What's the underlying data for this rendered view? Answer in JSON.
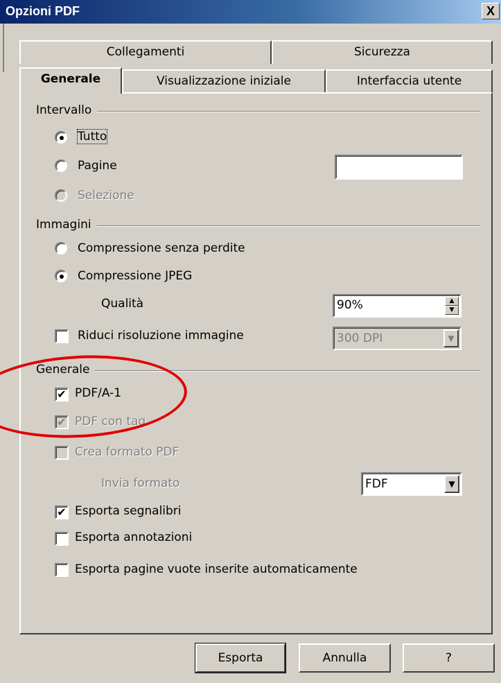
{
  "window": {
    "title": "Opzioni PDF",
    "close_glyph": "X"
  },
  "tabs": {
    "row_back": [
      "Collegamenti",
      "Sicurezza"
    ],
    "row_front": [
      "Generale",
      "Visualizzazione iniziale",
      "Interfaccia utente"
    ],
    "active": "Generale"
  },
  "intervallo": {
    "label": "Intervallo",
    "tutto": "Tutto",
    "pagine": "Pagine",
    "selezione": "Selezione",
    "selected": "Tutto",
    "pagine_value": ""
  },
  "immagini": {
    "label": "Immagini",
    "lossless": "Compressione senza perdite",
    "jpeg": "Compressione JPEG",
    "selected": "Compressione JPEG",
    "quality_label": "Qualità",
    "quality_value": "90%",
    "reduce_label": "Riduci risoluzione immagine",
    "reduce_checked": false,
    "dpi_value": "300 DPI"
  },
  "generale": {
    "label": "Generale",
    "pdfa": {
      "label": "PDF/A-1",
      "checked": true
    },
    "tagged": {
      "label": "PDF con tag",
      "checked": true,
      "disabled": true
    },
    "form": {
      "label": "Crea formato PDF",
      "checked": false,
      "disabled": true
    },
    "send_format_label": "Invia formato",
    "send_format_value": "FDF",
    "bookmarks": {
      "label": "Esporta segnalibri",
      "checked": true
    },
    "notes": {
      "label": "Esporta annotazioni",
      "checked": false
    },
    "empty_pages": {
      "label": "Esporta pagine vuote inserite automaticamente",
      "checked": false
    }
  },
  "buttons": {
    "export": "Esporta",
    "cancel": "Annulla",
    "help": "?"
  },
  "annotation": {
    "color": "#e00000",
    "shape": "ellipse"
  },
  "check_glyph": "✔"
}
